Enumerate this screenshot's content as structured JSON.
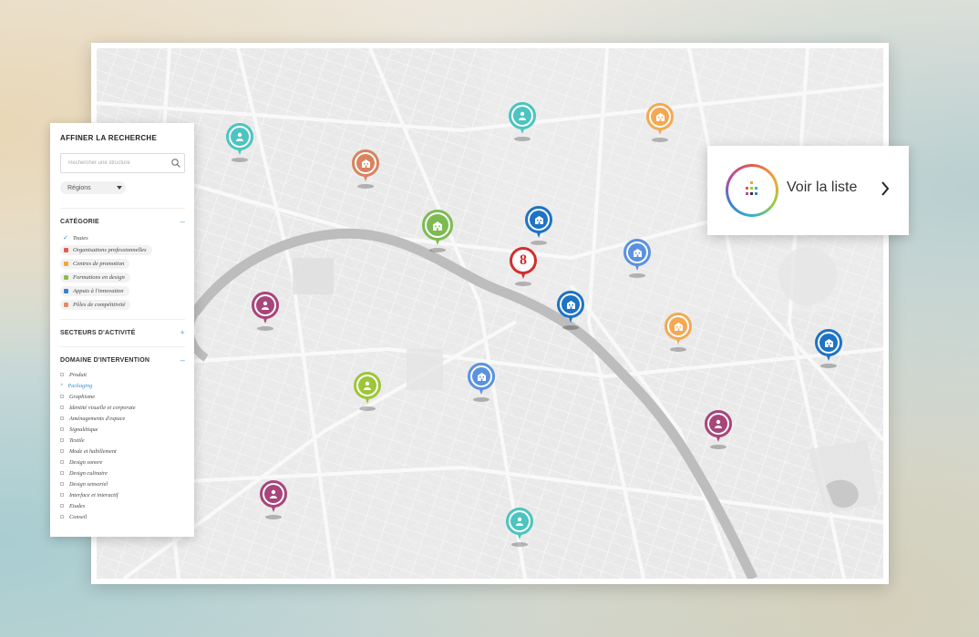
{
  "sidebar": {
    "title": "AFFINER LA RECHERCHE",
    "search_placeholder": "Rechercher une structure",
    "region_select": "Régions",
    "categorie": {
      "title": "CATÉGORIE",
      "toggle": "–",
      "items": [
        {
          "label": "Toutes",
          "color": ""
        },
        {
          "label": "Organisations professionnelles",
          "color": "#e25b52"
        },
        {
          "label": "Centres de promotion",
          "color": "#f3a73b"
        },
        {
          "label": "Formations en design",
          "color": "#8bbf4a"
        },
        {
          "label": "Appuis à l'innovation",
          "color": "#3b7ed3"
        },
        {
          "label": "Pôles de compétitivité",
          "color": "#e08a6a"
        }
      ]
    },
    "secteurs": {
      "title": "SECTEURS D'ACTIVITÉ",
      "toggle": "+"
    },
    "domaine": {
      "title": "DOMAINE D'INTERVENTION",
      "toggle": "–",
      "active_mark": "×",
      "items": [
        "Produit",
        "Packaging",
        "Graphisme",
        "Identité visuelle et corporate",
        "Aménagements d'espace",
        "Signalétique",
        "Textile",
        "Mode et habillement",
        "Design sonore",
        "Design culinaire",
        "Design sensoriel",
        "Interface et interactif",
        "Etudes",
        "Conseil"
      ]
    }
  },
  "list_button": {
    "label": "Voir la liste"
  },
  "cluster": {
    "count": "8"
  },
  "colors": {
    "teal": "#4cc4c0",
    "copper": "#d9845f",
    "green": "#7dbb52",
    "blue": "#1e73c4",
    "light_blue": "#5b92e0",
    "orange": "#f3a953",
    "plum": "#a8457a",
    "lime": "#9dc53a",
    "red": "#d22f2f"
  }
}
